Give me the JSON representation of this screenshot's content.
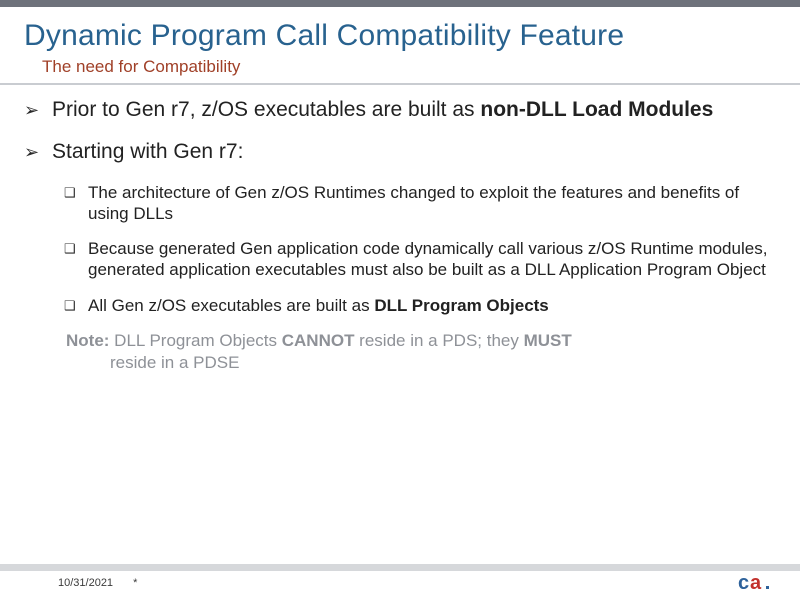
{
  "title": "Dynamic Program Call Compatibility Feature",
  "subtitle": "The need for Compatibility",
  "bullets": [
    {
      "pre": "Prior to Gen r7, z/OS executables are built as ",
      "bold": "non-DLL Load Modules",
      "post": ""
    },
    {
      "pre": "Starting with Gen r7:",
      "bold": "",
      "post": ""
    }
  ],
  "subbullets": [
    "The architecture of Gen z/OS Runtimes changed to exploit the features and benefits of using DLLs",
    "Because generated Gen application code dynamically call various z/OS Runtime modules, generated application executables must also be built as a DLL Application Program Object"
  ],
  "subbullet3": {
    "pre": "All Gen z/OS executables are built as ",
    "bold": "DLL Program Objects"
  },
  "note": {
    "lead": "Note:",
    "l1a": " DLL Program Objects ",
    "l1b": "CANNOT",
    "l1c": " reside in a PDS; they ",
    "l1d": "MUST",
    "l2": "reside in a PDSE"
  },
  "footer": {
    "date": "10/31/2021",
    "marker": "*"
  },
  "logo": {
    "name": "ca"
  }
}
